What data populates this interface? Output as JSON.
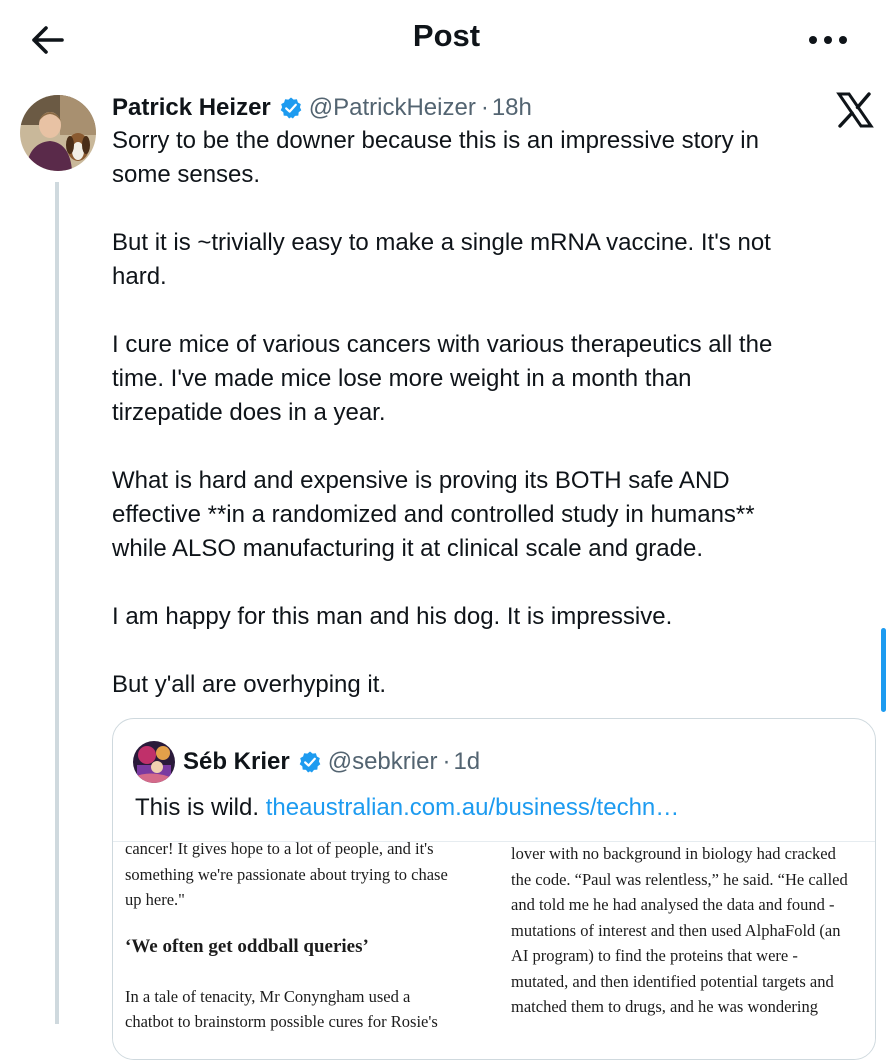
{
  "header": {
    "title": "Post",
    "back_icon": "arrow-left-icon",
    "more_icon": "more-dots-icon"
  },
  "post": {
    "author_name": "Patrick Heizer",
    "author_handle": "@PatrickHeizer",
    "separator": "·",
    "time": "18h",
    "verified_color": "#1d9bf0",
    "paragraphs": [
      "Sorry to be the downer because this is an impressive story in\nsome senses.",
      "But it is ~trivially easy to make a single mRNA vaccine. It's not\nhard.",
      "I cure mice of various cancers with various therapeutics all the\ntime. I've made mice lose more weight in a month than\ntirzepatide does in a year.",
      "What is hard and expensive is proving its BOTH safe AND\neffective **in a randomized and controlled study in humans**\nwhile ALSO manufacturing it at clinical scale and grade.",
      "I am happy for this man and his dog. It is impressive.",
      "But y'all are overhyping it."
    ]
  },
  "quote": {
    "author_name": "Séb Krier",
    "author_handle": "@sebkrier",
    "separator": "·",
    "time": "1d",
    "text": "This is wild.",
    "link": "theaustralian.com.au/business/techn…",
    "link_color": "#1d9bf0",
    "article": {
      "col1": {
        "para1_lines": [
          "cancer! It gives hope to a lot of people, and it's",
          "something we're passionate about trying to chase",
          "up here.\""
        ],
        "heading": "‘We often get oddball queries’",
        "para2_lines": [
          "In a tale of tenacity, Mr Conyngham used a",
          "chatbot to brainstorm possible cures for Rosie's"
        ]
      },
      "col2": {
        "lines": [
          "lover with no background in biology had cracked",
          "the code. “Paul was relentless,” he said. “He called",
          "and told me he had analysed the data and found -",
          "mutations of interest and then used AlphaFold (an",
          "AI program) to find the proteins that were -",
          "mutated, and then identified potential targets and",
          "matched them to drugs, and he was wondering"
        ]
      }
    }
  },
  "scrollbar": {
    "color": "#1d9bf0"
  }
}
